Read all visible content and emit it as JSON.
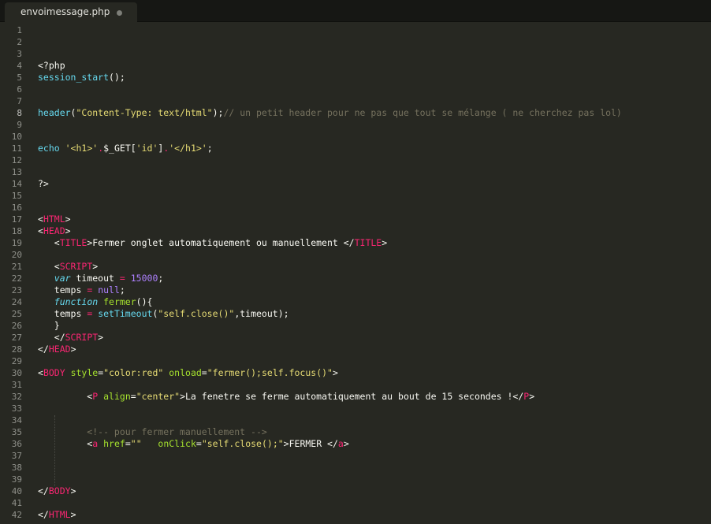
{
  "tab": {
    "title": "envoimessage.php",
    "dirty_indicator": "dot"
  },
  "theme": {
    "background": "#272822",
    "tabbar": "#161714",
    "text": "#f8f8f2",
    "function": "#66d9ef",
    "string": "#e6db74",
    "comment": "#75715e",
    "tag": "#f92672",
    "attribute": "#a6e22e",
    "number": "#ae81ff"
  },
  "editor": {
    "active_line": 8,
    "lines": [
      {
        "n": "1",
        "tokens": []
      },
      {
        "n": "2",
        "tokens": []
      },
      {
        "n": "3",
        "tokens": []
      },
      {
        "n": "4",
        "tokens": [
          {
            "c": "t-text",
            "s": "<?php"
          }
        ]
      },
      {
        "n": "5",
        "tokens": [
          {
            "c": "t-func",
            "s": "session_start"
          },
          {
            "c": "t-text",
            "s": "();"
          }
        ]
      },
      {
        "n": "6",
        "tokens": []
      },
      {
        "n": "7",
        "tokens": []
      },
      {
        "n": "8",
        "tokens": [
          {
            "c": "t-func",
            "s": "header"
          },
          {
            "c": "t-text",
            "s": "("
          },
          {
            "c": "t-str",
            "s": "\"Content-Type: text/html\""
          },
          {
            "c": "t-text",
            "s": ");"
          },
          {
            "c": "t-com",
            "s": "// un petit header pour ne pas que tout se mélange ( ne cherchez pas lol)"
          }
        ]
      },
      {
        "n": "9",
        "tokens": []
      },
      {
        "n": "10",
        "tokens": []
      },
      {
        "n": "11",
        "tokens": [
          {
            "c": "t-func",
            "s": "echo"
          },
          {
            "c": "t-text",
            "s": " "
          },
          {
            "c": "t-str",
            "s": "'<h1>'"
          },
          {
            "c": "t-op",
            "s": "."
          },
          {
            "c": "t-text",
            "s": "$_GET["
          },
          {
            "c": "t-str",
            "s": "'id'"
          },
          {
            "c": "t-text",
            "s": "]"
          },
          {
            "c": "t-op",
            "s": "."
          },
          {
            "c": "t-str",
            "s": "'</h1>'"
          },
          {
            "c": "t-text",
            "s": ";"
          }
        ]
      },
      {
        "n": "12",
        "tokens": []
      },
      {
        "n": "13",
        "tokens": []
      },
      {
        "n": "14",
        "tokens": [
          {
            "c": "t-text",
            "s": "?>"
          }
        ]
      },
      {
        "n": "15",
        "tokens": []
      },
      {
        "n": "16",
        "tokens": []
      },
      {
        "n": "17",
        "tokens": [
          {
            "c": "t-text",
            "s": "<"
          },
          {
            "c": "t-tag",
            "s": "HTML"
          },
          {
            "c": "t-text",
            "s": ">"
          }
        ]
      },
      {
        "n": "18",
        "tokens": [
          {
            "c": "t-text",
            "s": "<"
          },
          {
            "c": "t-tag",
            "s": "HEAD"
          },
          {
            "c": "t-text",
            "s": ">"
          }
        ]
      },
      {
        "n": "19",
        "tokens": [
          {
            "c": "t-text",
            "s": "   <"
          },
          {
            "c": "t-tag",
            "s": "TITLE"
          },
          {
            "c": "t-text",
            "s": ">Fermer onglet automatiquement ou manuellement </"
          },
          {
            "c": "t-tag",
            "s": "TITLE"
          },
          {
            "c": "t-text",
            "s": ">"
          }
        ]
      },
      {
        "n": "20",
        "tokens": []
      },
      {
        "n": "21",
        "tokens": [
          {
            "c": "t-text",
            "s": "   <"
          },
          {
            "c": "t-tag",
            "s": "SCRIPT"
          },
          {
            "c": "t-text",
            "s": ">"
          }
        ]
      },
      {
        "n": "22",
        "tokens": [
          {
            "c": "t-text",
            "s": "   "
          },
          {
            "c": "t-kw",
            "s": "var"
          },
          {
            "c": "t-text",
            "s": " timeout "
          },
          {
            "c": "t-op",
            "s": "="
          },
          {
            "c": "t-text",
            "s": " "
          },
          {
            "c": "t-num",
            "s": "15000"
          },
          {
            "c": "t-text",
            "s": ";"
          }
        ]
      },
      {
        "n": "23",
        "tokens": [
          {
            "c": "t-text",
            "s": "   temps "
          },
          {
            "c": "t-op",
            "s": "="
          },
          {
            "c": "t-text",
            "s": " "
          },
          {
            "c": "t-num",
            "s": "null"
          },
          {
            "c": "t-text",
            "s": ";"
          }
        ]
      },
      {
        "n": "24",
        "tokens": [
          {
            "c": "t-text",
            "s": "   "
          },
          {
            "c": "t-kw",
            "s": "function"
          },
          {
            "c": "t-text",
            "s": " "
          },
          {
            "c": "t-attr",
            "s": "fermer"
          },
          {
            "c": "t-text",
            "s": "(){"
          }
        ]
      },
      {
        "n": "25",
        "tokens": [
          {
            "c": "t-text",
            "s": "   temps "
          },
          {
            "c": "t-op",
            "s": "="
          },
          {
            "c": "t-text",
            "s": " "
          },
          {
            "c": "t-func",
            "s": "setTimeout"
          },
          {
            "c": "t-text",
            "s": "("
          },
          {
            "c": "t-str",
            "s": "\"self.close()\""
          },
          {
            "c": "t-text",
            "s": ",timeout);"
          }
        ]
      },
      {
        "n": "26",
        "tokens": [
          {
            "c": "t-text",
            "s": "   }"
          }
        ]
      },
      {
        "n": "27",
        "tokens": [
          {
            "c": "t-text",
            "s": "   </"
          },
          {
            "c": "t-tag",
            "s": "SCRIPT"
          },
          {
            "c": "t-text",
            "s": ">"
          }
        ]
      },
      {
        "n": "28",
        "tokens": [
          {
            "c": "t-text",
            "s": "</"
          },
          {
            "c": "t-tag",
            "s": "HEAD"
          },
          {
            "c": "t-text",
            "s": ">"
          }
        ]
      },
      {
        "n": "29",
        "tokens": []
      },
      {
        "n": "30",
        "tokens": [
          {
            "c": "t-text",
            "s": "<"
          },
          {
            "c": "t-tag",
            "s": "BODY"
          },
          {
            "c": "t-text",
            "s": " "
          },
          {
            "c": "t-attr",
            "s": "style"
          },
          {
            "c": "t-text",
            "s": "="
          },
          {
            "c": "t-str",
            "s": "\"color:red\""
          },
          {
            "c": "t-text",
            "s": " "
          },
          {
            "c": "t-attr",
            "s": "onload"
          },
          {
            "c": "t-text",
            "s": "="
          },
          {
            "c": "t-str",
            "s": "\"fermer();self.focus()\""
          },
          {
            "c": "t-text",
            "s": ">"
          }
        ]
      },
      {
        "n": "31",
        "tokens": []
      },
      {
        "n": "32",
        "tokens": [
          {
            "c": "t-text",
            "s": "         <"
          },
          {
            "c": "t-tag",
            "s": "P"
          },
          {
            "c": "t-text",
            "s": " "
          },
          {
            "c": "t-attr",
            "s": "align"
          },
          {
            "c": "t-text",
            "s": "="
          },
          {
            "c": "t-str",
            "s": "\"center\""
          },
          {
            "c": "t-text",
            "s": ">La fenetre se ferme automatiquement au bout de 15 secondes !</"
          },
          {
            "c": "t-tag",
            "s": "P"
          },
          {
            "c": "t-text",
            "s": ">"
          }
        ]
      },
      {
        "n": "33",
        "tokens": []
      },
      {
        "n": "34",
        "tokens": []
      },
      {
        "n": "35",
        "tokens": [
          {
            "c": "t-com",
            "s": "         <!-- pour fermer manuellement -->"
          }
        ]
      },
      {
        "n": "36",
        "tokens": [
          {
            "c": "t-text",
            "s": "         <"
          },
          {
            "c": "t-tag",
            "s": "a"
          },
          {
            "c": "t-text",
            "s": " "
          },
          {
            "c": "t-attr",
            "s": "href"
          },
          {
            "c": "t-text",
            "s": "="
          },
          {
            "c": "t-str",
            "s": "\"\""
          },
          {
            "c": "t-text",
            "s": "   "
          },
          {
            "c": "t-attr",
            "s": "onClick"
          },
          {
            "c": "t-text",
            "s": "="
          },
          {
            "c": "t-str",
            "s": "\"self.close();\""
          },
          {
            "c": "t-text",
            "s": ">FERMER </"
          },
          {
            "c": "t-tag",
            "s": "a"
          },
          {
            "c": "t-text",
            "s": ">"
          }
        ]
      },
      {
        "n": "37",
        "tokens": []
      },
      {
        "n": "38",
        "tokens": []
      },
      {
        "n": "39",
        "tokens": []
      },
      {
        "n": "40",
        "tokens": [
          {
            "c": "t-text",
            "s": "</"
          },
          {
            "c": "t-tag",
            "s": "BODY"
          },
          {
            "c": "t-text",
            "s": ">"
          }
        ]
      },
      {
        "n": "41",
        "tokens": []
      },
      {
        "n": "42",
        "tokens": [
          {
            "c": "t-text",
            "s": "</"
          },
          {
            "c": "t-tag",
            "s": "HTML"
          },
          {
            "c": "t-text",
            "s": ">"
          }
        ]
      }
    ]
  }
}
